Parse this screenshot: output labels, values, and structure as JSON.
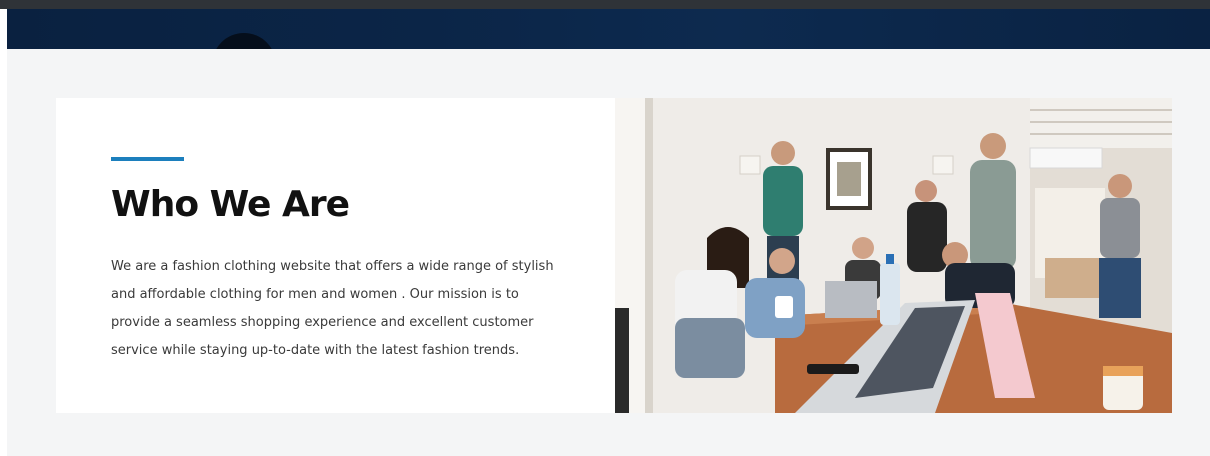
{
  "about": {
    "heading": "Who We Are",
    "description": "We are a fashion clothing website that offers a wide range of stylish and affordable clothing for men and women . Our mission is to provide a seamless shopping experience and excellent customer service while staying up-to-date with the latest fashion trends."
  },
  "colors": {
    "accent": "#1c7fbd",
    "background": "#f4f5f6",
    "header": "#0b2547"
  }
}
